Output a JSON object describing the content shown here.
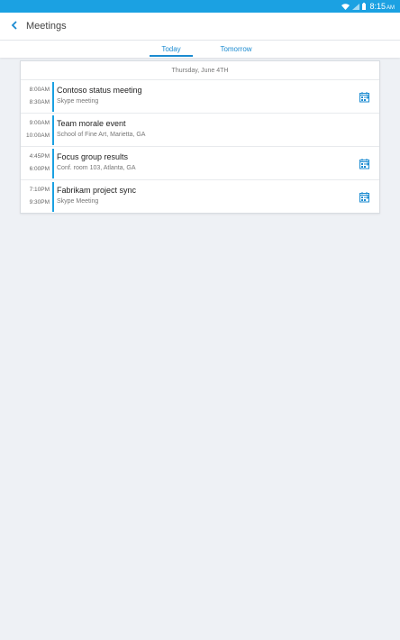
{
  "status": {
    "time": "8:15",
    "ampm": "AM"
  },
  "header": {
    "title": "Meetings"
  },
  "tabs": [
    {
      "label": "Today"
    },
    {
      "label": "Tomorrow"
    }
  ],
  "day": {
    "header": "Thursday, June 4TH"
  },
  "meetings": [
    {
      "start": "8:00AM",
      "end": "8:30AM",
      "subject": "Contoso status meeting",
      "location": "Skype meeting",
      "has_join": true
    },
    {
      "start": "9:00AM",
      "end": "10:00AM",
      "subject": "Team morale event",
      "location": "School of Fine Art, Marietta, GA",
      "has_join": false
    },
    {
      "start": "4:45PM",
      "end": "6:00PM",
      "subject": "Focus group results",
      "location": "Conf. room 103, Atlanta, GA",
      "has_join": true
    },
    {
      "start": "7:10PM",
      "end": "9:30PM",
      "subject": "Fabrikam project sync",
      "location": "Skype Meeting",
      "has_join": true
    }
  ],
  "colors": {
    "accent": "#1ba1e2",
    "status_bar": "#1ba1e2"
  }
}
